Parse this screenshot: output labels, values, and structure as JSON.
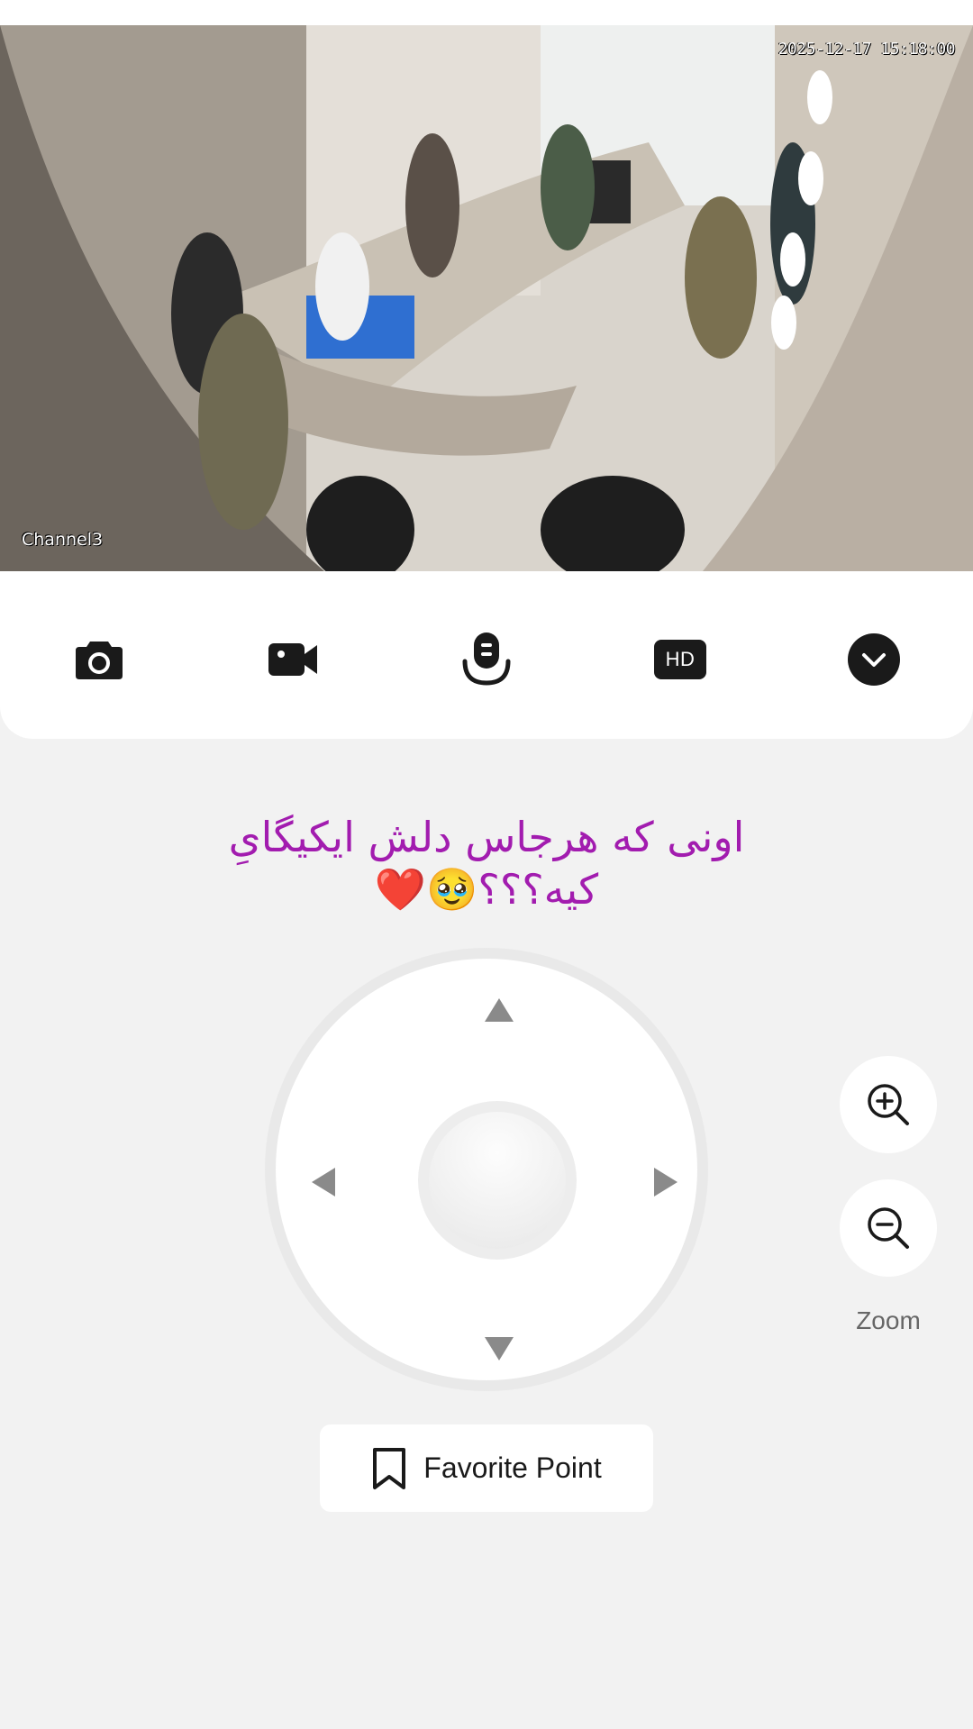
{
  "video": {
    "timestamp": "2025-12-17 15:18:00",
    "channel": "Channel3"
  },
  "toolbar": {
    "items": [
      {
        "icon": "camera-icon"
      },
      {
        "icon": "video-camera-icon"
      },
      {
        "icon": "microphone-icon"
      },
      {
        "icon": "hd-icon",
        "label": "HD"
      },
      {
        "icon": "chevron-down-icon"
      }
    ]
  },
  "caption": {
    "line1": "اونی که هرجاس دلش ایکیگایِ",
    "line2": "کیه؟؟؟🥹❤️",
    "color": "#a21caf"
  },
  "zoom": {
    "label": "Zoom",
    "in_icon": "zoom-in-icon",
    "out_icon": "zoom-out-icon"
  },
  "favorite": {
    "label": "Favorite Point",
    "icon": "bookmark-icon"
  }
}
